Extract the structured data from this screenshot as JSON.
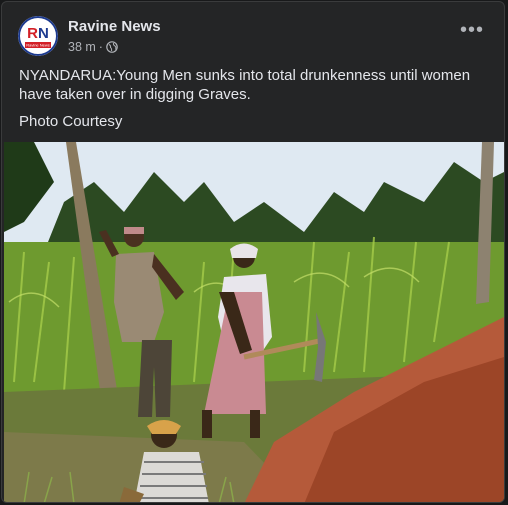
{
  "post": {
    "author": "Ravine News",
    "timestamp": "38 m",
    "separator": "·",
    "privacy_icon": "globe-icon",
    "menu_icon": "more-options-icon",
    "menu_label": "•••",
    "text_line1": "NYANDARUA:Young Men sunks into total drunkenness until women have taken over in digging Graves.",
    "text_line2": "Photo Courtesy",
    "avatar_logo_text": "RN",
    "avatar_small_text": "Ravine News"
  },
  "colors": {
    "card_bg": "#242526",
    "text_primary": "#e4e6eb",
    "text_secondary": "#b0b3b8",
    "logo_red": "#d32027",
    "logo_blue": "#1c3a8f"
  }
}
